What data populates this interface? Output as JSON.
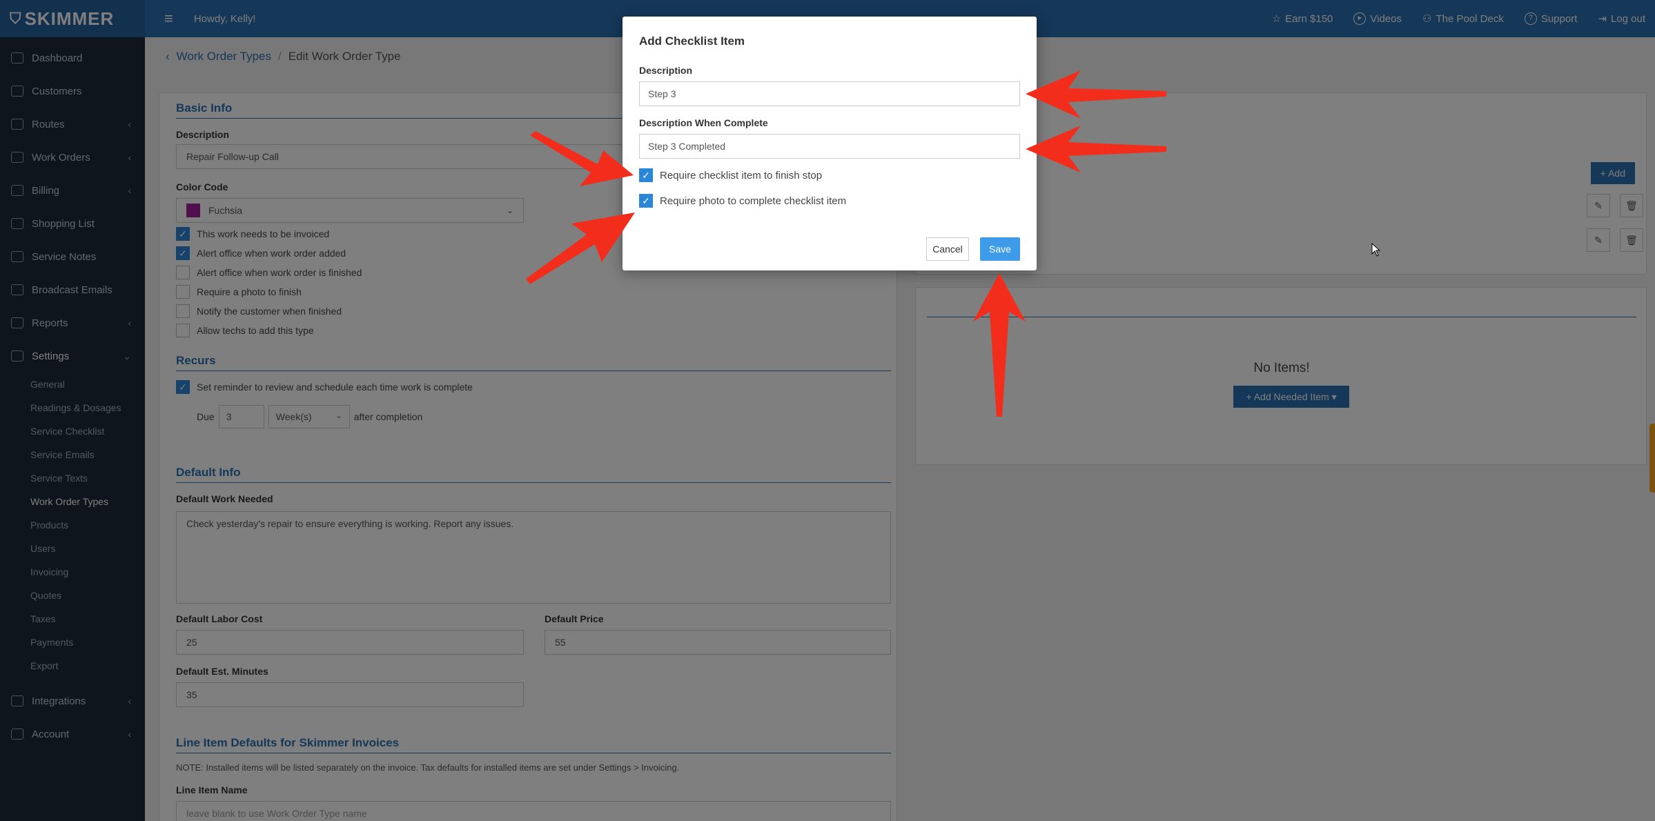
{
  "brand": {
    "name": "SKIMMER",
    "primary": "#2a6fb0",
    "sidebar_bg": "#1d2b3a",
    "annotation_arrow": "#f22d1c"
  },
  "topbar": {
    "greeting": "Howdy, Kelly!",
    "links": [
      {
        "label": "Earn $150",
        "icon": "star-icon"
      },
      {
        "label": "Videos",
        "icon": "play-icon"
      },
      {
        "label": "The Pool Deck",
        "icon": "people-icon"
      },
      {
        "label": "Support",
        "icon": "help-icon"
      },
      {
        "label": "Log out",
        "icon": "logout-icon"
      }
    ]
  },
  "sidebar": {
    "items": [
      {
        "label": "Dashboard"
      },
      {
        "label": "Customers"
      },
      {
        "label": "Routes"
      },
      {
        "label": "Work Orders"
      },
      {
        "label": "Billing"
      },
      {
        "label": "Shopping List"
      },
      {
        "label": "Service Notes"
      },
      {
        "label": "Broadcast Emails"
      },
      {
        "label": "Reports"
      },
      {
        "label": "Settings"
      }
    ],
    "settings_sub": [
      "General",
      "Readings & Dosages",
      "Service Checklist",
      "Service Emails",
      "Service Texts",
      "Work Order Types",
      "Products",
      "Users",
      "Invoicing",
      "Quotes",
      "Taxes",
      "Payments",
      "Export"
    ],
    "bottom_items": [
      {
        "label": "Integrations"
      },
      {
        "label": "Account"
      }
    ]
  },
  "breadcrumb": {
    "link": "Work Order Types",
    "separator": "/",
    "current": "Edit Work Order Type"
  },
  "basic_info": {
    "title": "Basic Info",
    "description_label": "Description",
    "description_value": "Repair Follow-up Call",
    "color_label": "Color Code",
    "color_value": "Fuchsia",
    "checks": [
      {
        "label": "This work needs to be invoiced",
        "checked": true
      },
      {
        "label": "Alert office when work order added",
        "checked": true
      },
      {
        "label": "Alert office when work order is finished",
        "checked": false
      },
      {
        "label": "Require a photo to finish",
        "checked": false
      },
      {
        "label": "Notify the customer when finished",
        "checked": false
      },
      {
        "label": "Allow techs to add this type",
        "checked": false
      }
    ]
  },
  "recurs": {
    "title": "Recurs",
    "check_label": "Set reminder to review and schedule each time work is complete",
    "due_label": "Due",
    "due_value": "3",
    "unit_value": "Week(s)",
    "after_label": "after completion"
  },
  "default_info": {
    "title": "Default Info",
    "work_needed_label": "Default Work Needed",
    "work_needed_value": "Check yesterday's repair to ensure everything is working. Report any issues.",
    "labor_cost_label": "Default Labor Cost",
    "labor_cost_value": "25",
    "price_label": "Default Price",
    "price_value": "55",
    "minutes_label": "Default Est. Minutes",
    "minutes_value": "35"
  },
  "line_item": {
    "title": "Line Item Defaults for Skimmer Invoices",
    "note": "NOTE: Installed items will be listed separately on the invoice. Tax defaults for installed items are set under Settings > Invoicing.",
    "name_label": "Line Item Name",
    "name_placeholder": "leave blank to use Work Order Type name"
  },
  "right_panel": {
    "add_label": "+ Add",
    "no_items": "No Items!",
    "add_needed_label": "+ Add Needed Item ▾"
  },
  "modal": {
    "title": "Add Checklist Item",
    "description_label": "Description",
    "description_value": "Step 3",
    "complete_label": "Description When Complete",
    "complete_value": "Step 3 Completed",
    "check1_label": "Require checklist item to finish stop",
    "check1_checked": true,
    "check2_label": "Require photo to complete checklist item",
    "check2_checked": true,
    "cancel_label": "Cancel",
    "save_label": "Save"
  }
}
